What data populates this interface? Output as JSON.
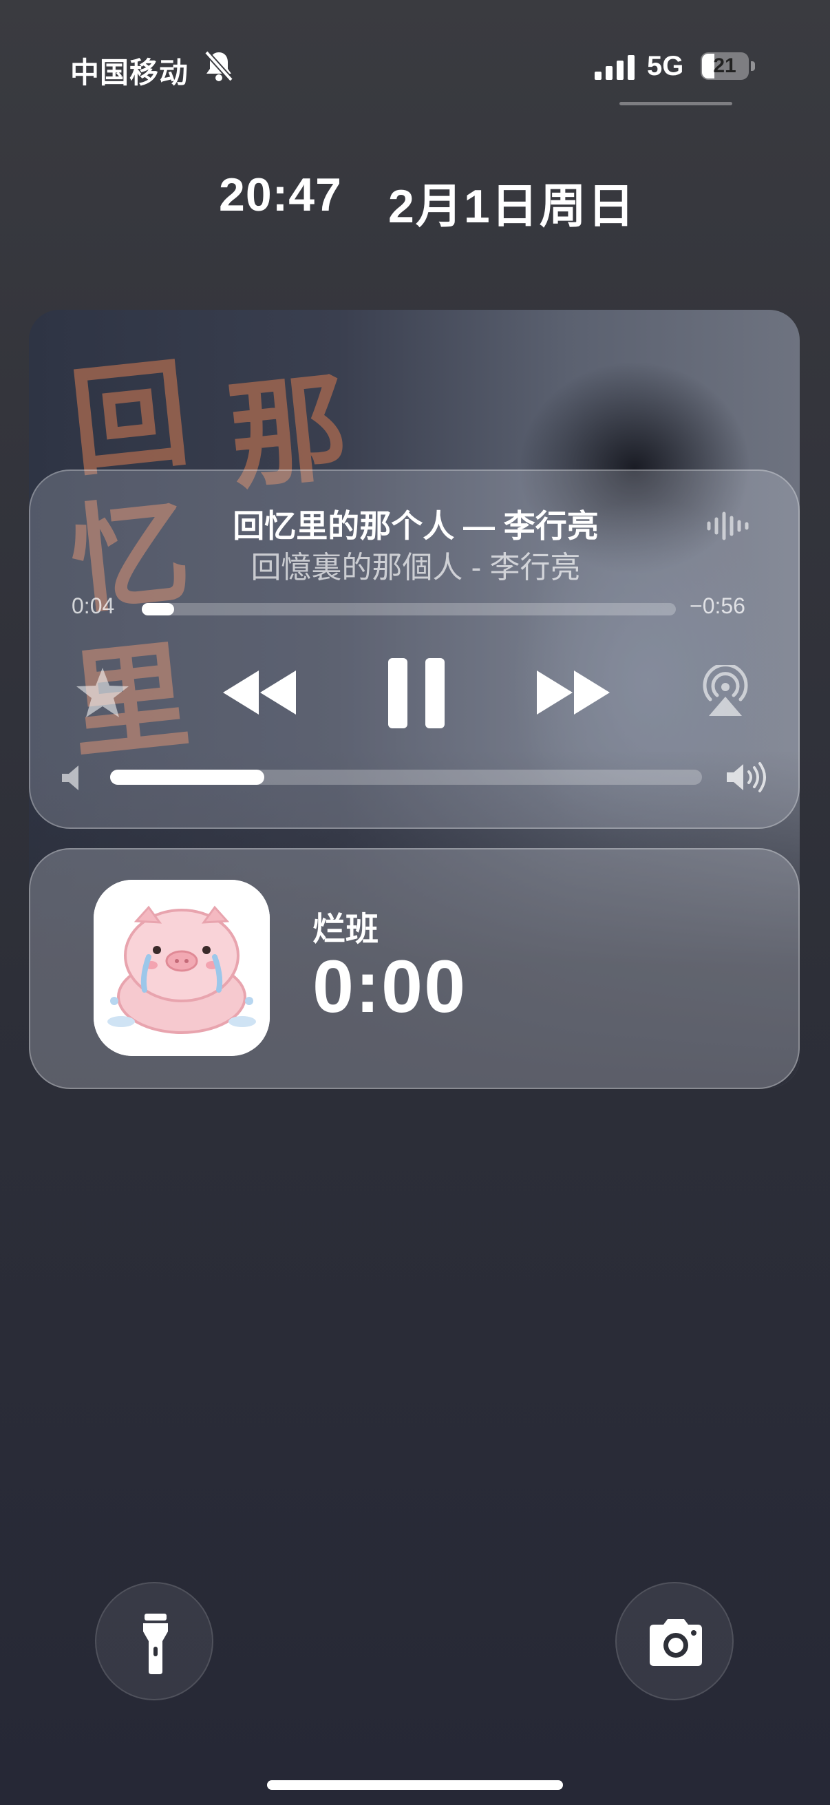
{
  "status_bar": {
    "carrier": "中国移动",
    "network": "5G",
    "battery_level": "21",
    "icons": [
      "silent-bell-icon",
      "signal-icon",
      "battery-icon"
    ]
  },
  "lock": {
    "time": "20:47",
    "date": "2月1日周日"
  },
  "now_playing": {
    "title": "回忆里的那个人 — 李行亮",
    "subtitle": "回憶裏的那個人 - 李行亮",
    "elapsed": "0:04",
    "remaining": "−0:56",
    "progress_fraction": 0.06,
    "volume_fraction": 0.26,
    "controls": [
      "star-icon",
      "rewind-icon",
      "pause-icon",
      "fast-forward-icon",
      "airplay-icon"
    ]
  },
  "timer": {
    "label": "烂班",
    "value": "0:00"
  },
  "quick_actions": {
    "left": "flashlight-icon",
    "right": "camera-icon"
  }
}
